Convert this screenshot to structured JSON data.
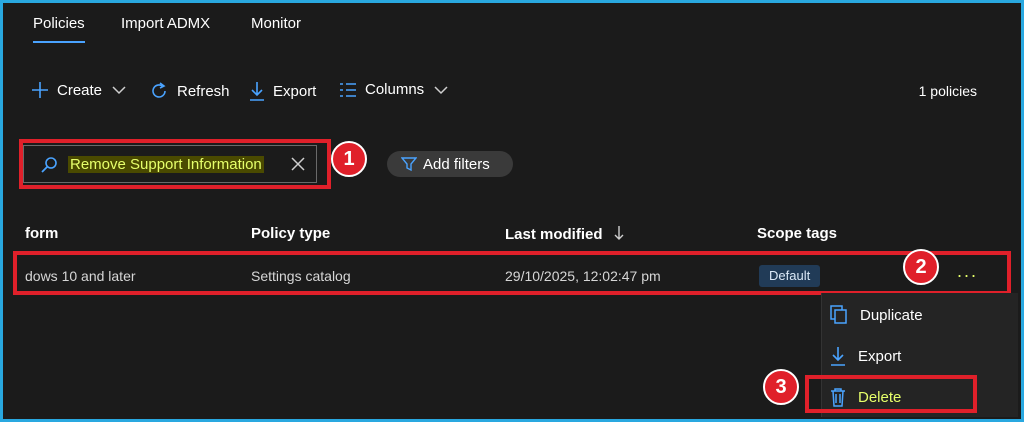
{
  "tabs": [
    {
      "label": "Policies",
      "active": true
    },
    {
      "label": "Import ADMX",
      "active": false
    },
    {
      "label": "Monitor",
      "active": false
    }
  ],
  "toolbar": {
    "create_label": "Create",
    "refresh_label": "Refresh",
    "export_label": "Export",
    "columns_label": "Columns",
    "policy_count": "1 policies"
  },
  "search": {
    "value": "Remove Support Information"
  },
  "filters": {
    "add_label": "Add filters"
  },
  "table": {
    "columns": [
      "form",
      "Policy type",
      "Last modified",
      "Scope tags"
    ],
    "rows": [
      {
        "platform": "dows 10 and later",
        "policy_type": "Settings catalog",
        "last_modified": "29/10/2025, 12:02:47 pm",
        "scope_tag": "Default",
        "more": "..."
      }
    ]
  },
  "context_menu": {
    "items": [
      {
        "label": "Duplicate"
      },
      {
        "label": "Export"
      },
      {
        "label": "Delete"
      }
    ]
  },
  "annotations": {
    "step1": "1",
    "step2": "2",
    "step3": "3"
  },
  "colors": {
    "accent": "#4aa3ff",
    "highlight_box": "#e0202a",
    "highlight_text": "#e6ff6a",
    "frame": "#29a8e0"
  }
}
